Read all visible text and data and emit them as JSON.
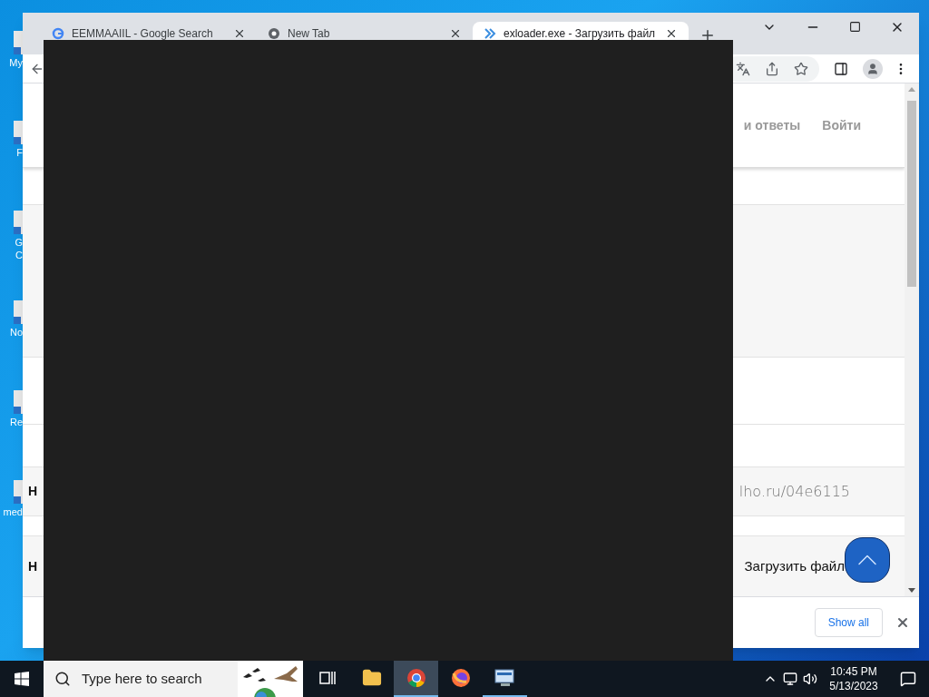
{
  "desktop_icons": [
    {
      "lines": [
        "My"
      ]
    },
    {
      "lines": [
        "F"
      ]
    },
    {
      "lines": [
        "G",
        "C"
      ]
    },
    {
      "lines": [
        "No"
      ]
    },
    {
      "lines": [
        "Re"
      ]
    },
    {
      "lines": [
        "med"
      ]
    }
  ],
  "browser": {
    "tabs": [
      {
        "title": "EEMMAAIIL - Google Search",
        "kind": "google",
        "selected": false
      },
      {
        "title": "New Tab",
        "kind": "chrome",
        "selected": false
      },
      {
        "title": "exloader.exe - Загрузить файл",
        "kind": "chevrons",
        "selected": true
      }
    ],
    "nav": [
      "и ответы",
      "Войти"
    ],
    "rows": [
      {
        "kind": "panel"
      },
      {
        "kind": "blank"
      },
      {
        "kind": "blank"
      },
      {
        "kind": "url",
        "heading": "H",
        "text": "lho.ru/04e6115"
      },
      {
        "kind": "title",
        "heading": "H",
        "text": "Загрузить файл"
      }
    ],
    "download_bar": {
      "button": "Show all"
    }
  },
  "taskbar": {
    "search_placeholder": "Type here to search",
    "apps": [
      {
        "kind": "taskview",
        "selected": false,
        "running": false
      },
      {
        "kind": "explorer",
        "selected": false,
        "running": false
      },
      {
        "kind": "chrome",
        "selected": true,
        "running": true
      },
      {
        "kind": "firefox",
        "selected": false,
        "running": false
      },
      {
        "kind": "monitor",
        "selected": false,
        "running": true
      }
    ],
    "time": "10:45 PM",
    "date": "5/13/2023"
  }
}
